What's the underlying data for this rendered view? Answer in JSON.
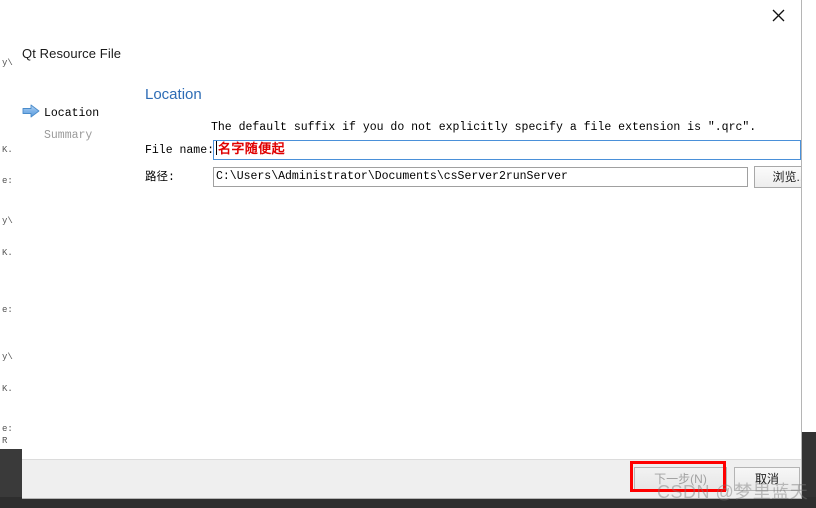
{
  "window": {
    "title": "Qt Resource File",
    "close_icon": "close-icon"
  },
  "steps": [
    {
      "label": "Location",
      "state": "current",
      "icon": "blue-arrow-icon"
    },
    {
      "label": "Summary",
      "state": "upcoming",
      "icon": ""
    }
  ],
  "pane": {
    "title": "Location",
    "hint": "The default suffix if you do not explicitly specify a file extension is \".qrc\"."
  },
  "fields": {
    "file_name": {
      "label": "File name:",
      "value": "名字随便起",
      "placeholder": "",
      "text_color": "#e00000",
      "border_color": "#4a90d9"
    },
    "path": {
      "label": "路径:",
      "value": "C:\\Users\\Administrator\\Documents\\csServer2runServer",
      "placeholder": "",
      "browse_label": "浏览..."
    }
  },
  "buttons": {
    "next": {
      "label": "下一步(N)",
      "enabled": false
    },
    "cancel": {
      "label": "取消",
      "enabled": true
    }
  },
  "annotation": {
    "highlight_color": "#ff0000",
    "target": "next-button"
  },
  "watermark": {
    "text": "CSDN @梦里蓝天"
  },
  "background": {
    "editor_fragments": [
      "y\\",
      "K.",
      "e:",
      "y\\",
      "K.",
      "e:",
      "y\\",
      "K.",
      "e:",
      "R"
    ]
  }
}
